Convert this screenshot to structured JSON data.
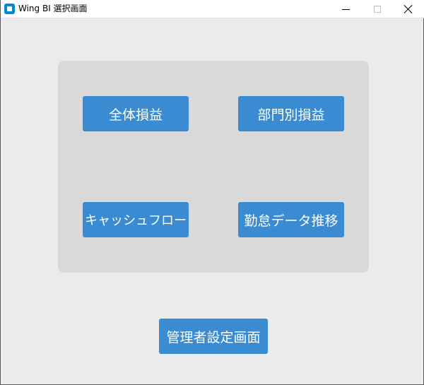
{
  "window": {
    "title": "Wing BI 選択画面",
    "icon": "app-icon",
    "controls": [
      "minimize-icon",
      "maximize-icon",
      "close-icon"
    ]
  },
  "colors": {
    "accent": "#3a8bd1",
    "panel": "#d9d9d9",
    "background": "#ebebeb"
  },
  "menu": {
    "overall_pl": "全体損益",
    "department_pl": "部門別損益",
    "cash_flow": "キャッシュフロー",
    "attendance_trend": "勤怠データ推移"
  },
  "admin": {
    "settings_label": "管理者設定画面"
  }
}
